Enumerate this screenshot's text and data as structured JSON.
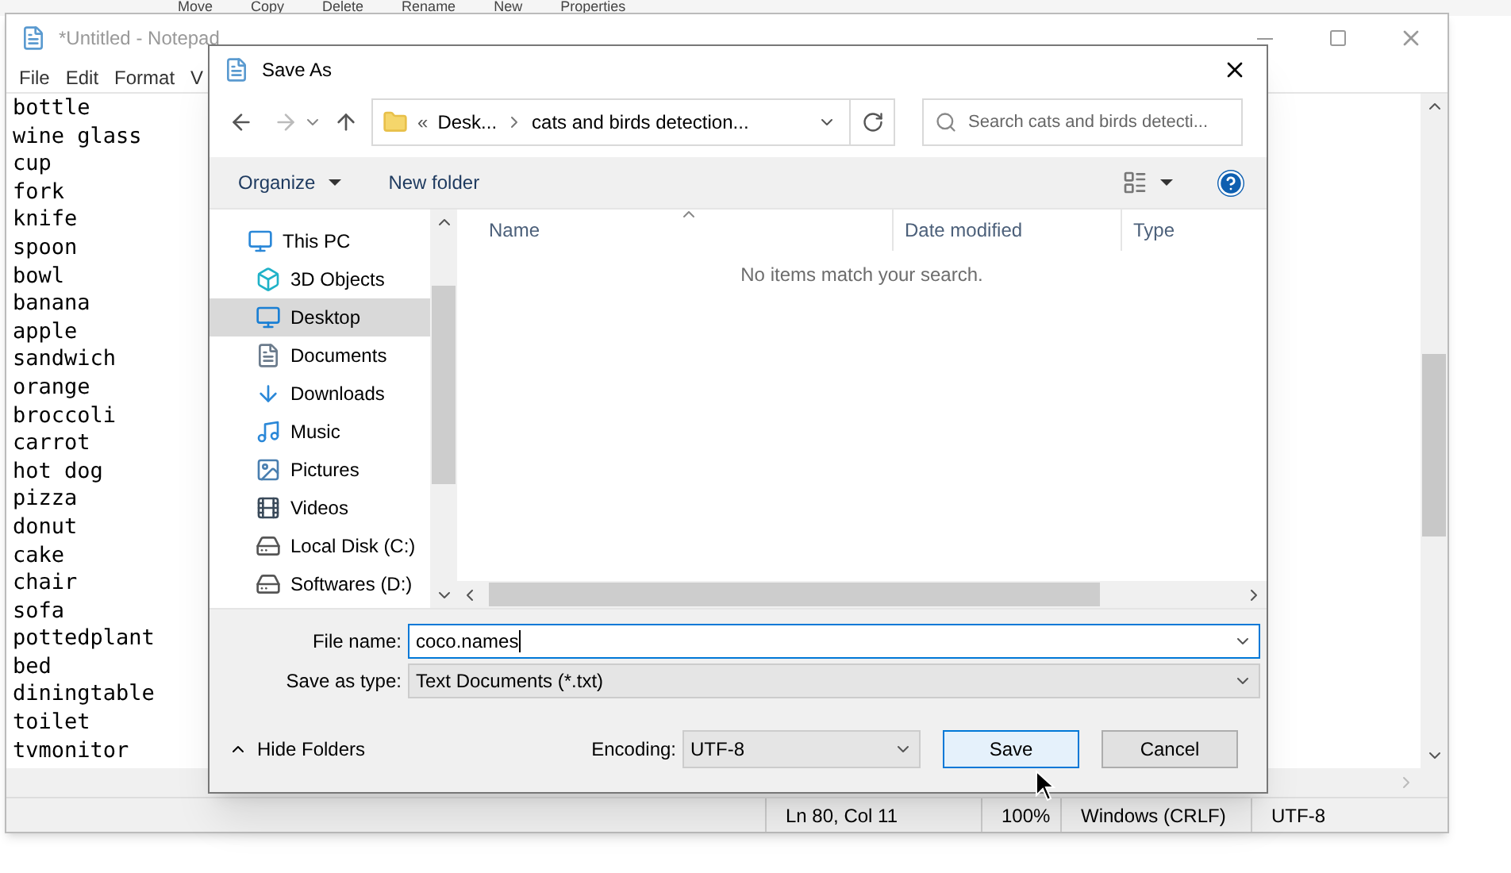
{
  "background_ribbon": [
    "Move",
    "Copy",
    "Delete",
    "Rename",
    "New",
    "Properties"
  ],
  "notepad": {
    "title": "*Untitled - Notepad",
    "menu": [
      "File",
      "Edit",
      "Format",
      "V"
    ],
    "lines": [
      "bottle",
      "wine glass",
      "cup",
      "fork",
      "knife",
      "spoon",
      "bowl",
      "banana",
      "apple",
      "sandwich",
      "orange",
      "broccoli",
      "carrot",
      "hot dog",
      "pizza",
      "donut",
      "cake",
      "chair",
      "sofa",
      "pottedplant",
      "bed",
      "diningtable",
      "toilet",
      "tvmonitor"
    ],
    "status_bar": [
      "Ln 80, Col 11",
      "100%",
      "Windows (CRLF)",
      "UTF-8"
    ]
  },
  "dialog": {
    "title": "Save As",
    "breadcrumb": {
      "overflow": "«",
      "segments": [
        "Desk...",
        "cats and birds detection..."
      ]
    },
    "search": {
      "placeholder": "Search cats and birds detecti..."
    },
    "toolbar": [
      {
        "label": "Organize",
        "kind": "menu"
      },
      {
        "label": "New folder",
        "kind": "button"
      }
    ],
    "nav_items": [
      {
        "label": "This PC",
        "kind": "pc",
        "selected": false
      },
      {
        "label": "3D Objects",
        "kind": "objects",
        "selected": false
      },
      {
        "label": "Desktop",
        "kind": "desktop",
        "selected": true
      },
      {
        "label": "Documents",
        "kind": "documents",
        "selected": false
      },
      {
        "label": "Downloads",
        "kind": "downloads",
        "selected": false
      },
      {
        "label": "Music",
        "kind": "music",
        "selected": false
      },
      {
        "label": "Pictures",
        "kind": "pictures",
        "selected": false
      },
      {
        "label": "Videos",
        "kind": "videos",
        "selected": false
      },
      {
        "label": "Local Disk (C:)",
        "kind": "disk",
        "selected": false
      },
      {
        "label": "Softwares (D:)",
        "kind": "disk",
        "selected": false
      }
    ],
    "columns": [
      "Name",
      "Date modified",
      "Type"
    ],
    "empty_message": "No items match your search.",
    "file_name": {
      "label": "File name:",
      "value": "coco.names"
    },
    "save_as_type": {
      "label": "Save as type:",
      "value": "Text Documents (*.txt)"
    },
    "hide_folders": "Hide Folders",
    "encoding": {
      "label": "Encoding:",
      "value": "UTF-8"
    },
    "buttons": [
      {
        "label": "Save",
        "default": true
      },
      {
        "label": "Cancel",
        "default": false
      }
    ]
  }
}
